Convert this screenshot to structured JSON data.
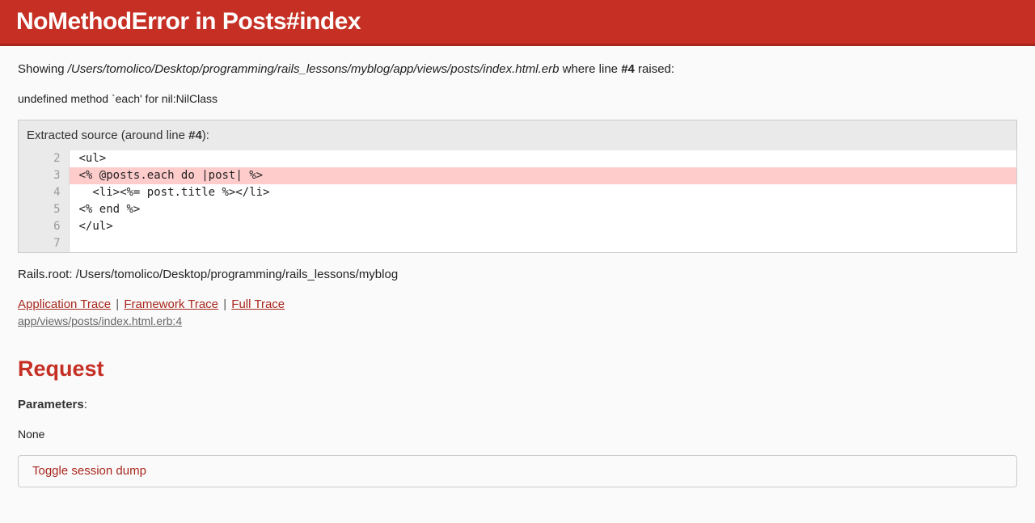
{
  "header": {
    "title": "NoMethodError in Posts#index"
  },
  "showing": {
    "prefix": "Showing ",
    "filepath": "/Users/tomolico/Desktop/programming/rails_lessons/myblog/app/views/posts/index.html.erb",
    "mid": " where line ",
    "line": "#4",
    "suffix": " raised:"
  },
  "error_message": "undefined method `each' for nil:NilClass",
  "extracted": {
    "prefix": "Extracted source (around line ",
    "line": "#4",
    "suffix": "):"
  },
  "source": {
    "highlight_line": 4,
    "lines": [
      {
        "num": 2,
        "code": ""
      },
      {
        "num": 3,
        "code": "<ul>"
      },
      {
        "num": 4,
        "code": "<% @posts.each do |post| %>"
      },
      {
        "num": 5,
        "code": "  <li><%= post.title %></li>"
      },
      {
        "num": 6,
        "code": "<% end %>"
      },
      {
        "num": 7,
        "code": "</ul>"
      }
    ]
  },
  "rails_root": "Rails.root: /Users/tomolico/Desktop/programming/rails_lessons/myblog",
  "traces": {
    "application": "Application Trace",
    "framework": "Framework Trace",
    "full": "Full Trace"
  },
  "trace_line": "app/views/posts/index.html.erb:4",
  "request": {
    "heading": "Request",
    "params_label": "Parameters",
    "params_colon": ":",
    "params_value": "None"
  },
  "toggles": {
    "session": "Toggle session dump"
  }
}
